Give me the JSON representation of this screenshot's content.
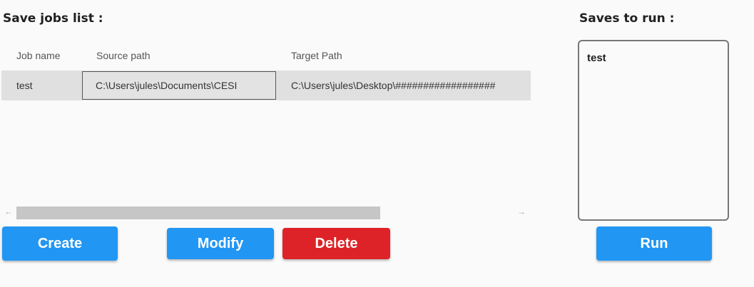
{
  "left_panel": {
    "title": "Save jobs list :",
    "grid": {
      "columns": [
        "Job name",
        "Source path",
        "Target Path"
      ],
      "rows": [
        {
          "job_name": "test",
          "source_path": "C:\\Users\\jules\\Documents\\CESI",
          "target_path": "C:\\Users\\jules\\Desktop\\##################"
        }
      ]
    },
    "scrollbar": {
      "left_arrow": "←",
      "right_arrow": "→"
    },
    "buttons": {
      "create": "Create",
      "modify": "Modify",
      "delete": "Delete"
    }
  },
  "right_panel": {
    "title": "Saves to run :",
    "items": [
      "test"
    ],
    "run_button": "Run"
  },
  "colors": {
    "primary_button": "#2196f3",
    "danger_button": "#dd2327",
    "row_background": "#e0e0e0",
    "page_background": "#fafafa"
  }
}
